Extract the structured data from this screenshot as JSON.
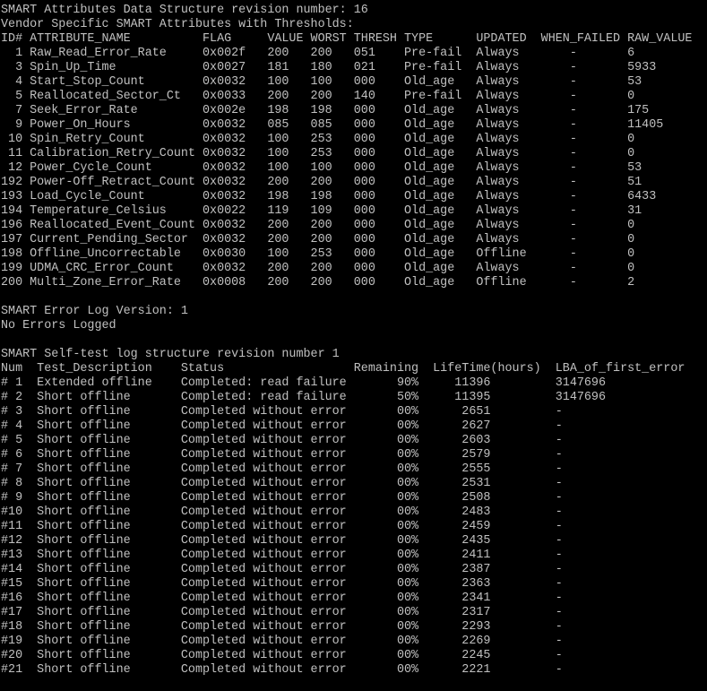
{
  "terminal": {
    "attributes_header": {
      "revision": "SMART Attributes Data Structure revision number: 16",
      "vendor": "Vendor Specific SMART Attributes with Thresholds:",
      "columns": "ID# ATTRIBUTE_NAME          FLAG     VALUE WORST THRESH TYPE      UPDATED  WHEN_FAILED RAW_VALUE"
    },
    "attributes": [
      "  1 Raw_Read_Error_Rate     0x002f   200   200   051    Pre-fail  Always       -       6",
      "  3 Spin_Up_Time            0x0027   181   180   021    Pre-fail  Always       -       5933",
      "  4 Start_Stop_Count        0x0032   100   100   000    Old_age   Always       -       53",
      "  5 Reallocated_Sector_Ct   0x0033   200   200   140    Pre-fail  Always       -       0",
      "  7 Seek_Error_Rate         0x002e   198   198   000    Old_age   Always       -       175",
      "  9 Power_On_Hours          0x0032   085   085   000    Old_age   Always       -       11405",
      " 10 Spin_Retry_Count        0x0032   100   253   000    Old_age   Always       -       0",
      " 11 Calibration_Retry_Count 0x0032   100   253   000    Old_age   Always       -       0",
      " 12 Power_Cycle_Count       0x0032   100   100   000    Old_age   Always       -       53",
      "192 Power-Off_Retract_Count 0x0032   200   200   000    Old_age   Always       -       51",
      "193 Load_Cycle_Count        0x0032   198   198   000    Old_age   Always       -       6433",
      "194 Temperature_Celsius     0x0022   119   109   000    Old_age   Always       -       31",
      "196 Reallocated_Event_Count 0x0032   200   200   000    Old_age   Always       -       0",
      "197 Current_Pending_Sector  0x0032   200   200   000    Old_age   Always       -       0",
      "198 Offline_Uncorrectable   0x0030   100   253   000    Old_age   Offline      -       0",
      "199 UDMA_CRC_Error_Count    0x0032   200   200   000    Old_age   Always       -       0",
      "200 Multi_Zone_Error_Rate   0x0008   200   200   000    Old_age   Offline      -       2"
    ],
    "error_log": {
      "version": "SMART Error Log Version: 1",
      "status": "No Errors Logged"
    },
    "selftest_header": {
      "revision": "SMART Self-test log structure revision number 1",
      "columns": "Num  Test_Description    Status                  Remaining  LifeTime(hours)  LBA_of_first_error"
    },
    "selftests": [
      "# 1  Extended offline    Completed: read failure       90%     11396         3147696",
      "# 2  Short offline       Completed: read failure       50%     11395         3147696",
      "# 3  Short offline       Completed without error       00%      2651         -",
      "# 4  Short offline       Completed without error       00%      2627         -",
      "# 5  Short offline       Completed without error       00%      2603         -",
      "# 6  Short offline       Completed without error       00%      2579         -",
      "# 7  Short offline       Completed without error       00%      2555         -",
      "# 8  Short offline       Completed without error       00%      2531         -",
      "# 9  Short offline       Completed without error       00%      2508         -",
      "#10  Short offline       Completed without error       00%      2483         -",
      "#11  Short offline       Completed without error       00%      2459         -",
      "#12  Short offline       Completed without error       00%      2435         -",
      "#13  Short offline       Completed without error       00%      2411         -",
      "#14  Short offline       Completed without error       00%      2387         -",
      "#15  Short offline       Completed without error       00%      2363         -",
      "#16  Short offline       Completed without error       00%      2341         -",
      "#17  Short offline       Completed without error       00%      2317         -",
      "#18  Short offline       Completed without error       00%      2293         -",
      "#19  Short offline       Completed without error       00%      2269         -",
      "#20  Short offline       Completed without error       00%      2245         -",
      "#21  Short offline       Completed without error       00%      2221         -"
    ],
    "colors": {
      "background": "#000000",
      "foreground": "#c0c0c0"
    }
  }
}
